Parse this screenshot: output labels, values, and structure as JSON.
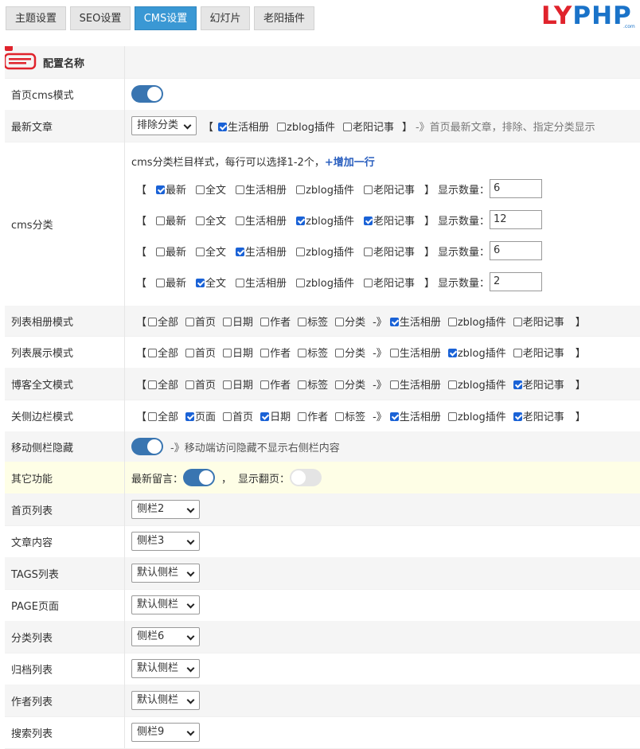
{
  "tabs": [
    "主题设置",
    "SEO设置",
    "CMS设置",
    "幻灯片",
    "老阳插件"
  ],
  "active_tab": "CMS设置",
  "logo": {
    "text_red": "LY",
    "text_blue": "PHP",
    "domain": ".com"
  },
  "header": {
    "title": "配置名称"
  },
  "rows": {
    "home_cms": {
      "label": "首页cms模式"
    },
    "latest": {
      "label": "最新文章",
      "select": "排除分类",
      "open": "【",
      "close": "】",
      "options": [
        "生活相册",
        "zblog插件",
        "老阳记事"
      ],
      "hint": "-》首页最新文章，排除、指定分类显示"
    },
    "cms": {
      "label": "cms分类",
      "desc": "cms分类栏目样式，每行可以选择1-2个，",
      "add": "+增加一行",
      "count_label": "显示数量：",
      "lines": [
        {
          "checked": [
            1,
            0,
            0,
            0,
            0
          ],
          "count": "6"
        },
        {
          "checked": [
            0,
            0,
            0,
            1,
            1
          ],
          "count": "12"
        },
        {
          "checked": [
            0,
            0,
            1,
            0,
            0
          ],
          "count": "6"
        },
        {
          "checked": [
            0,
            1,
            0,
            0,
            0
          ],
          "count": "2"
        }
      ],
      "options": [
        "最新",
        "全文",
        "生活相册",
        "zblog插件",
        "老阳记事"
      ]
    },
    "album": {
      "label": "列表相册模式",
      "checked": [
        0,
        0,
        0,
        0,
        0,
        0,
        1,
        0,
        0
      ]
    },
    "list": {
      "label": "列表展示模式",
      "checked": [
        0,
        0,
        0,
        0,
        0,
        0,
        0,
        1,
        0
      ]
    },
    "blog": {
      "label": "博客全文模式",
      "checked": [
        0,
        0,
        0,
        0,
        0,
        0,
        0,
        0,
        1
      ]
    },
    "sidebar": {
      "label": "关侧边栏模式",
      "options": [
        "全部",
        "页面",
        "首页",
        "日期",
        "作者",
        "标签",
        "生活相册",
        "zblog插件",
        "老阳记事"
      ],
      "checked": [
        0,
        1,
        0,
        1,
        0,
        0,
        1,
        0,
        1
      ]
    },
    "mobile": {
      "label": "移动侧栏隐藏",
      "hint": "-》移动端访问隐藏不显示右侧栏内容"
    },
    "other": {
      "label": "其它功能",
      "msg": "最新留言：",
      "sep": "，",
      "page": "显示翻页："
    },
    "homelist": {
      "label": "首页列表",
      "select": "侧栏2"
    },
    "article": {
      "label": "文章内容",
      "select": "侧栏3"
    },
    "tags": {
      "label": "TAGS列表",
      "select": "默认侧栏"
    },
    "page": {
      "label": "PAGE页面",
      "select": "默认侧栏"
    },
    "catlist": {
      "label": "分类列表",
      "select": "侧栏6"
    },
    "archive": {
      "label": "归档列表",
      "select": "默认侧栏"
    },
    "author": {
      "label": "作者列表",
      "select": "默认侧栏"
    },
    "search": {
      "label": "搜索列表",
      "select": "侧栏9"
    }
  },
  "list_options": [
    "全部",
    "首页",
    "日期",
    "作者",
    "标签",
    "分类",
    "生活相册",
    "zblog插件",
    "老阳记事"
  ],
  "arrow": "-》",
  "open": "【",
  "close": "】",
  "colors": {
    "accent": "#3a98d4",
    "toggle": "#3975b1",
    "highlight": "#fefee6"
  }
}
